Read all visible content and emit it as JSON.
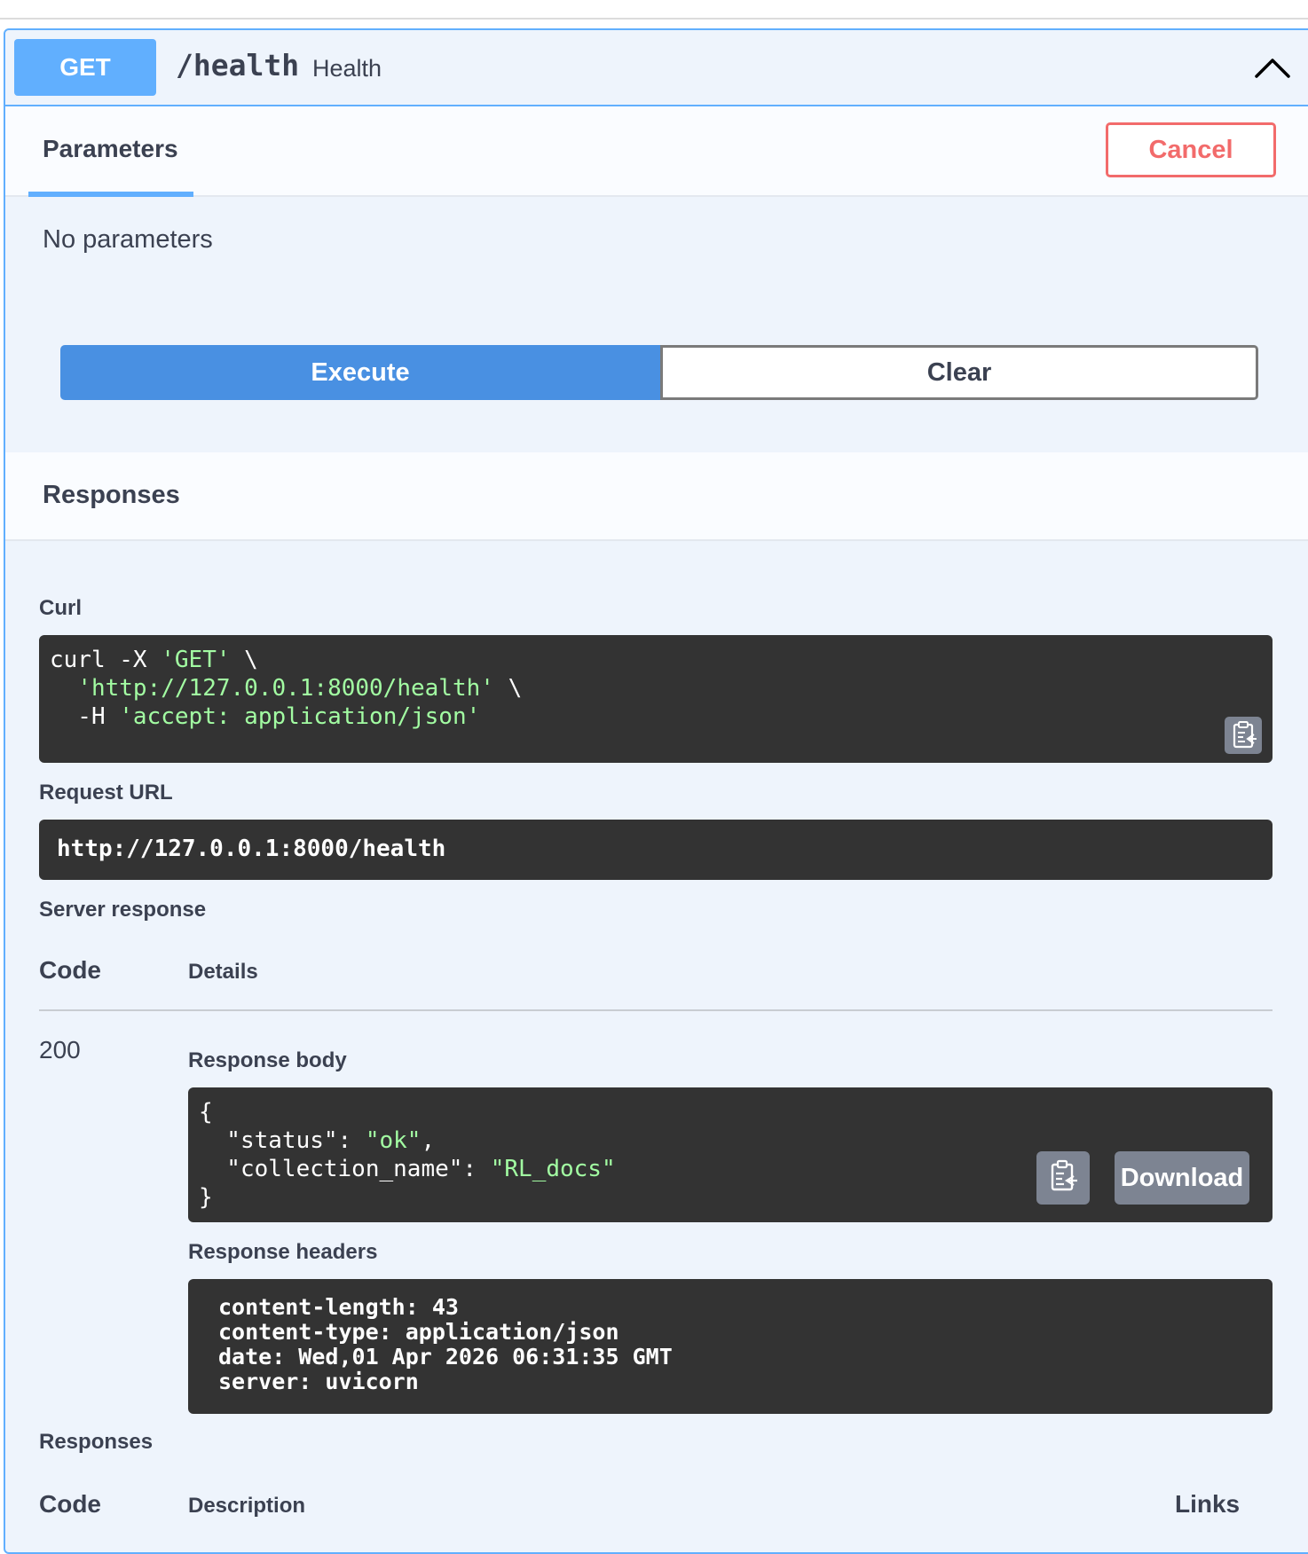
{
  "operation": {
    "method": "GET",
    "path": "/health",
    "summary": "Health"
  },
  "tabs": {
    "parameters_label": "Parameters",
    "cancel_label": "Cancel"
  },
  "parameters": {
    "empty_text": "No parameters"
  },
  "actions": {
    "execute_label": "Execute",
    "clear_label": "Clear"
  },
  "responses_section": {
    "title": "Responses"
  },
  "curl": {
    "label": "Curl",
    "line1_cmd": "curl -X ",
    "line1_method": "'GET'",
    "line1_tail": " \\",
    "line2_indent": "  ",
    "line2_url": "'http://127.0.0.1:8000/health'",
    "line2_tail": " \\",
    "line3_flag": "  -H ",
    "line3_header": "'accept: application/json'"
  },
  "request_url": {
    "label": "Request URL",
    "value": "http://127.0.0.1:8000/health"
  },
  "server_response": {
    "label": "Server response",
    "code_header": "Code",
    "details_header": "Details",
    "code": "200",
    "body_label": "Response body",
    "body": {
      "open": "{",
      "key1": "  \"status\": ",
      "val1": "\"ok\"",
      "comma1": ",",
      "key2": "  \"collection_name\": ",
      "val2": "\"RL_docs\"",
      "close": "}"
    },
    "download_label": "Download",
    "headers_label": "Response headers",
    "headers": [
      "content-length: 43",
      "content-type: application/json",
      "date: Wed,01 Apr 2026 06:31:35 GMT",
      "server: uvicorn"
    ]
  },
  "responses_table": {
    "label": "Responses",
    "code_header": "Code",
    "description_header": "Description",
    "links_header": "Links"
  },
  "colors": {
    "get_accent": "#61affe",
    "execute_blue": "#4990e2",
    "cancel_red": "#f26b6b",
    "code_bg": "#333333",
    "string_green": "#a2fca2"
  },
  "icons": {
    "collapse": "chevron-up-icon",
    "copy": "clipboard-icon"
  }
}
